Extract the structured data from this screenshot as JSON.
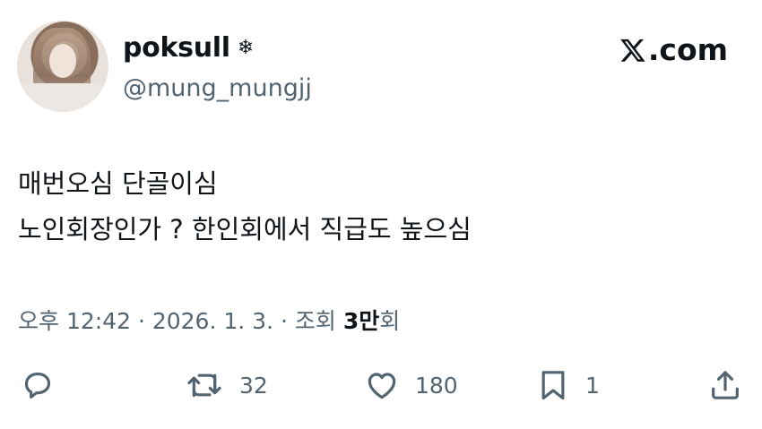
{
  "user": {
    "display_name": "poksull",
    "badge": "❄",
    "handle": "@mung_mungjj"
  },
  "brand": {
    "logo_text": ".com",
    "icon": "x-logo-icon"
  },
  "tweet": {
    "lines": [
      "매번오심 단골이심",
      "노인회장인가 ? 한인회에서 직급도 높으심"
    ]
  },
  "meta": {
    "time": "오후 12:42",
    "sep1": " · ",
    "date": "2026. 1. 3.",
    "sep2": " · ",
    "views_label": "조회 ",
    "views_number": "3만",
    "views_unit": "회"
  },
  "actions": {
    "reply": {
      "icon": "reply-icon"
    },
    "retweet": {
      "icon": "retweet-icon",
      "count": "32"
    },
    "like": {
      "icon": "heart-icon",
      "count": "180"
    },
    "bookmark": {
      "icon": "bookmark-icon",
      "count": "1"
    },
    "share": {
      "icon": "share-icon"
    }
  },
  "colors": {
    "text": "#0f1419",
    "muted": "#536471",
    "background": "#ffffff"
  }
}
